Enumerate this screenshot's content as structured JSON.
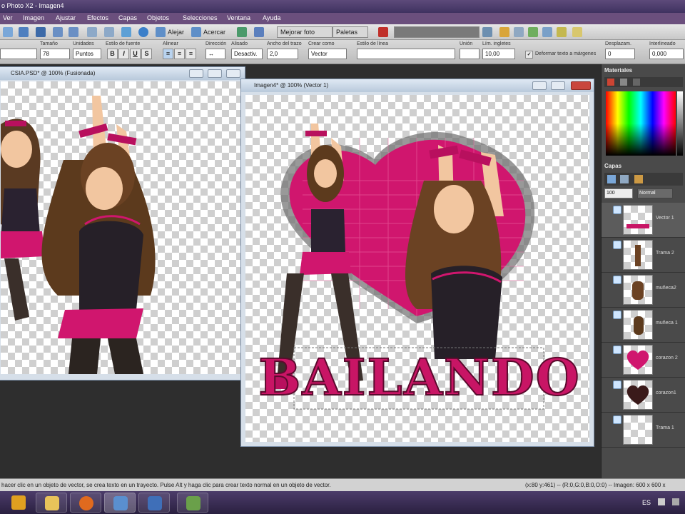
{
  "app": {
    "title": "o Photo X2 - Imagen4"
  },
  "menu": [
    "Ver",
    "Imagen",
    "Ajustar",
    "Efectos",
    "Capas",
    "Objetos",
    "Selecciones",
    "Ventana",
    "Ayuda"
  ],
  "toolbar": {
    "alejar_label": "Alejar",
    "acercar_label": "Acercar",
    "mejorar_foto_label": "Mejorar foto",
    "paletas_label": "Paletas"
  },
  "options": {
    "tamano_label": "Tamaño",
    "tamano_value": "78",
    "unidades_label": "Unidades",
    "unidades_value": "Puntos",
    "estilo_fuente_label": "Estilo de fuente",
    "alinear_label": "Alinear",
    "direccion_label": "Dirección",
    "alisado_label": "Alisado",
    "alisado_value": "Desactiv.",
    "ancho_trazo_label": "Ancho del trazo",
    "ancho_trazo_value": "2,0",
    "crear_como_label": "Crear como",
    "crear_como_value": "Vector",
    "estilo_linea_label": "Estilo de línea",
    "union_label": "Unión",
    "lim_ingletes_label": "Lím. ingletes",
    "lim_ingletes_value": "10,00",
    "deformar_label": "Deformar texto a márgenes",
    "desplazam_label": "Desplazam.",
    "desplazam_value": "0",
    "interlineado_label": "Interlineado",
    "interlineado_value": "0,000",
    "font_value": "",
    "bold_label": "B",
    "italic_label": "I",
    "underline_label": "U"
  },
  "documents": {
    "left_title": "CSIA.PSD* @ 100% (Fusionada)",
    "right_title": "Imagen4* @ 100% (Vector 1)",
    "banner_text": "BAILANDO"
  },
  "panels": {
    "materiales_title": "Materiales",
    "capas_title": "Capas",
    "opacity_value": "100",
    "blend_mode": "Normal",
    "layers": [
      {
        "name": "Vector 1",
        "thumb": "text"
      },
      {
        "name": "Trama 2",
        "thumb": "figure"
      },
      {
        "name": "muñeca2",
        "thumb": "figure"
      },
      {
        "name": "muñeca 1",
        "thumb": "figure"
      },
      {
        "name": "corazon 2",
        "thumb": "heart-pink"
      },
      {
        "name": "corazon1",
        "thumb": "heart-dark"
      },
      {
        "name": "Trama 1",
        "thumb": "empty"
      }
    ]
  },
  "status": {
    "hint": "hacer clic en un objeto de vector, se crea texto en un trayecto. Pulse Alt y haga clic para crear texto normal en un objeto de vector.",
    "coords": "(x:80 y:461) -- (R:0,G:0,B:0,O:0) -- Imagen: 600 x 600 x"
  },
  "taskbar": {
    "lang": "ES"
  },
  "colors": {
    "accent_pink": "#d0166e",
    "menu_purple": "#6b4f7d",
    "taskbar_purple": "#3a2d52"
  }
}
